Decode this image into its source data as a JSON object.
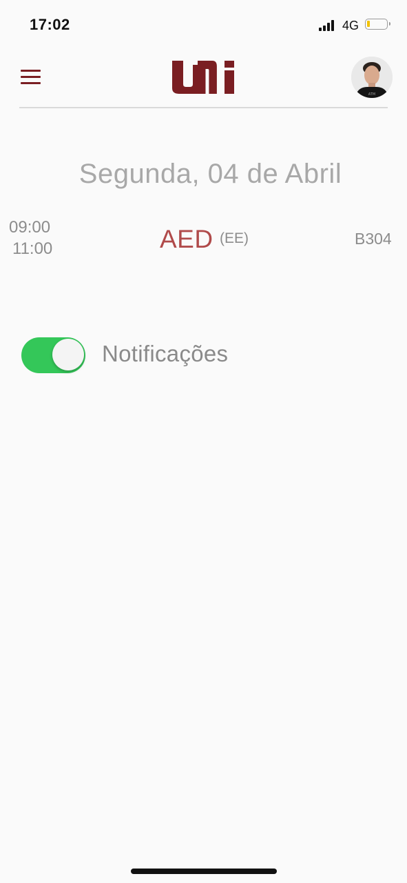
{
  "status_bar": {
    "time": "17:02",
    "network": "4G",
    "battery_level": 0.1,
    "battery_color": "#f2c200"
  },
  "header": {
    "menu_icon": "hamburger-menu-icon",
    "logo_text": "UNI",
    "brand_color": "#7a1e22",
    "avatar": "user-profile-photo"
  },
  "schedule": {
    "date_title": "Segunda, 04 de Abril",
    "classes": [
      {
        "start_time": "09:00",
        "end_time": "11:00",
        "course": "AED",
        "type": "(EE)",
        "room": "B304",
        "course_color": "#b04a4a"
      }
    ]
  },
  "settings": {
    "notifications_label": "Notificações",
    "notifications_enabled": true,
    "toggle_color": "#34c759"
  }
}
